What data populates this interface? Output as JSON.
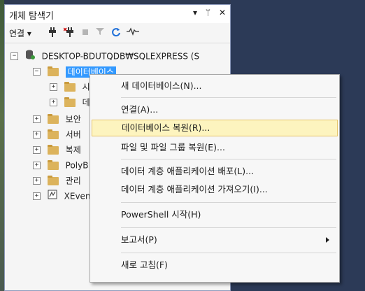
{
  "panel": {
    "title": "개체 탐색기",
    "title_buttons": [
      "▾",
      "ᛘ",
      "✕"
    ]
  },
  "toolbar": {
    "connect_label": "연결 ▾"
  },
  "tree": {
    "server": "DESKTOP-BDUTQDB₩SQLEXPRESS (S",
    "databases": "데이터베이스",
    "db_child1": "시",
    "db_child2": "데",
    "security": "보안",
    "server_objects": "서버",
    "replication": "복제",
    "polybase": "PolyB",
    "management": "관리",
    "xevent": "XEven"
  },
  "menu": {
    "new_db": "새 데이터베이스(N)...",
    "attach": "연결(A)...",
    "restore_db": "데이터베이스 복원(R)...",
    "restore_files": "파일 및 파일 그룹 복원(E)...",
    "deploy_dac": "데이터 계층 애플리케이션 배포(L)...",
    "import_dac": "데이터 계층 애플리케이션 가져오기(I)...",
    "powershell": "PowerShell 시작(H)",
    "reports": "보고서(P)",
    "refresh": "새로 고침(F)"
  }
}
